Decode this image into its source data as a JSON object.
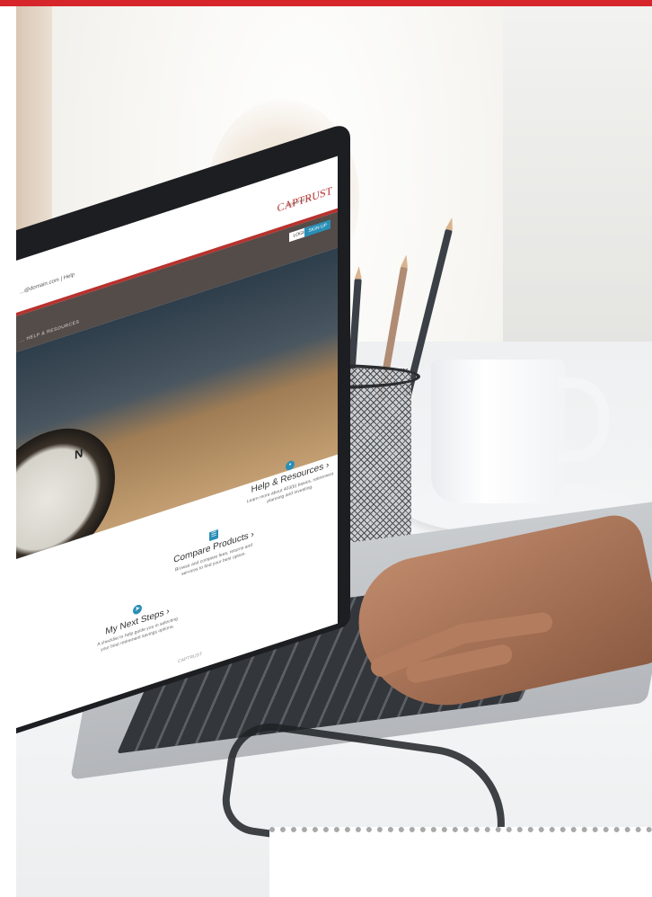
{
  "screen": {
    "header": {
      "meta_text": "...@domain.com | Help",
      "powered_by": "Powered by",
      "brand": "CAPTRUST"
    },
    "nav": {
      "links": "... HELP & RESOURCES",
      "button_primary": "LOGIN",
      "button_secondary": "SIGN UP"
    },
    "hero": {
      "compass_letter": "N"
    },
    "cards": [
      {
        "title": "My Next Steps ›",
        "description": "A checklist to help guide you in selecting your best retirement savings options.",
        "icon": "compass-icon"
      },
      {
        "title": "Compare Products ›",
        "description": "Browse and compare fees, returns and services to find your best option.",
        "icon": "document-icon"
      },
      {
        "title": "Help & Resources ›",
        "description": "Learn more about 403(b) basics, retirement planning and investing.",
        "icon": "chat-icon"
      }
    ],
    "footer_mark": "CAPTRUST"
  },
  "colors": {
    "top_bar": "#d6262b",
    "brand_red": "#b7322e",
    "nav_brown": "#534c49",
    "accent_blue": "#2a8fb7"
  }
}
